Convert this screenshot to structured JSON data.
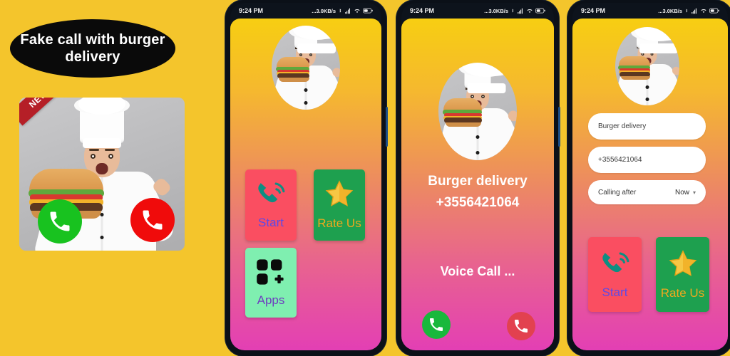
{
  "app": {
    "promo_title": "Fake call with burger delivery",
    "badge": "NEW !",
    "background_color": "#F4C52C"
  },
  "statusbar": {
    "time": "9:24 PM",
    "network_speed": "...3.0KB/s",
    "icons": [
      "bluetooth-icon",
      "signal-icon",
      "wifi-icon",
      "battery-icon"
    ]
  },
  "screens": [
    {
      "id": "home",
      "avatar_alt": "chef-holding-burger-avatar",
      "buttons": [
        {
          "label": "Start",
          "icon": "phone-call-icon",
          "color": "#FA4E61",
          "text_color": "#5B4AE8"
        },
        {
          "label": "Rate Us",
          "icon": "star-icon",
          "color": "#1EA04F",
          "text_color": "#F0A81E"
        },
        {
          "label": "Apps",
          "icon": "apps-grid-icon",
          "color": "#7FEFB0",
          "text_color": "#6D3FBF"
        }
      ]
    },
    {
      "id": "incoming-call",
      "caller_name": "Burger delivery",
      "caller_number": "+3556421064",
      "call_state": "Voice Call ...",
      "accept_icon": "phone-accept-icon",
      "decline_icon": "phone-decline-icon",
      "accept_color": "#19B83C",
      "decline_color": "#E2414F"
    },
    {
      "id": "setup",
      "fields": [
        {
          "name": "caller-name-input",
          "value": "Burger delivery"
        },
        {
          "name": "caller-number-input",
          "value": "+3556421064"
        }
      ],
      "delay_label": "Calling after",
      "delay_value": "Now",
      "buttons": [
        {
          "label": "Start",
          "icon": "phone-call-icon",
          "color": "#FA4E61",
          "text_color": "#5B4AE8"
        },
        {
          "label": "Rate Us",
          "icon": "star-icon",
          "color": "#1EA04F",
          "text_color": "#F0A81E"
        }
      ]
    }
  ]
}
